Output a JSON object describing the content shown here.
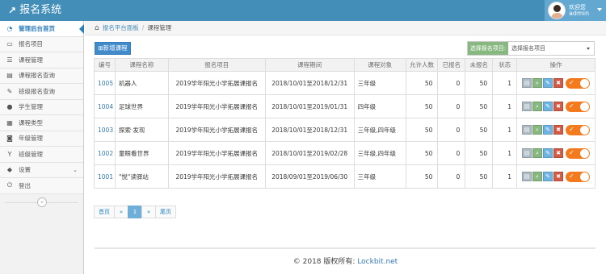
{
  "header": {
    "app_title": "报名系统",
    "welcome": "欢迎您",
    "username": "admin"
  },
  "sidebar": {
    "items": [
      {
        "label": "管理后台首页",
        "icon": "dashboard-icon",
        "glyph": "◔"
      },
      {
        "label": "报名项目",
        "icon": "monitor-icon",
        "glyph": "▭"
      },
      {
        "label": "课程管理",
        "icon": "list-icon",
        "glyph": "☰"
      },
      {
        "label": "课程报名查询",
        "icon": "list-alt-icon",
        "glyph": "▤"
      },
      {
        "label": "班级报名查询",
        "icon": "edit-icon",
        "glyph": "✎"
      },
      {
        "label": "学生管理",
        "icon": "user-icon",
        "glyph": "●"
      },
      {
        "label": "课程类型",
        "icon": "calendar-icon",
        "glyph": "▦"
      },
      {
        "label": "年级管理",
        "icon": "car-icon",
        "glyph": "◙"
      },
      {
        "label": "班级管理",
        "icon": "glass-icon",
        "glyph": "Y"
      },
      {
        "label": "设置",
        "icon": "tag-icon",
        "glyph": "◆"
      },
      {
        "label": "登出",
        "icon": "power-icon",
        "glyph": "⏻"
      }
    ],
    "collapse_glyph": "«"
  },
  "breadcrumb": {
    "home": "报名平台面板",
    "current": "课程管理",
    "separator": "/"
  },
  "toolbar": {
    "add_label": "新增课程",
    "filter_label": "选择报名项目:",
    "filter_value": "选择报名项目"
  },
  "table": {
    "columns": [
      "编号",
      "课程名称",
      "报名项目",
      "课程期间",
      "课程对象",
      "允许人数",
      "已报名",
      "未报名",
      "状态",
      "操作"
    ],
    "rows": [
      {
        "id": "1005",
        "name": "机器人",
        "project": "2019学年阳光小学拓展课报名",
        "period": "2018/10/01至2018/12/31",
        "target": "三年级",
        "allowed": "50",
        "enrolled": "0",
        "remaining": "50",
        "status": "1"
      },
      {
        "id": "1004",
        "name": "足球世界",
        "project": "2019学年阳光小学拓展课报名",
        "period": "2018/10/01至2019/01/31",
        "target": "四年级",
        "allowed": "50",
        "enrolled": "0",
        "remaining": "50",
        "status": "1"
      },
      {
        "id": "1003",
        "name": "探索·发现",
        "project": "2019学年阳光小学拓展课报名",
        "period": "2018/10/01至2018/12/31",
        "target": "三年级,四年级",
        "allowed": "50",
        "enrolled": "0",
        "remaining": "50",
        "status": "1"
      },
      {
        "id": "1002",
        "name": "童眼看世界",
        "project": "2019学年阳光小学拓展课报名",
        "period": "2018/10/01至2019/02/28",
        "target": "三年级,四年级",
        "allowed": "50",
        "enrolled": "0",
        "remaining": "50",
        "status": "1"
      },
      {
        "id": "1001",
        "name": "\"悦\"读驿站",
        "project": "2019学年阳光小学拓展课报名",
        "period": "2018/09/01至2019/06/30",
        "target": "三年级",
        "allowed": "50",
        "enrolled": "0",
        "remaining": "50",
        "status": "1"
      }
    ]
  },
  "pagination": {
    "first": "首页",
    "prev": "«",
    "current": "1",
    "next": "»",
    "last": "尾页"
  },
  "footer": {
    "copyright": "© 2018 版权所有:",
    "link": "Lockbit.net"
  },
  "colors": {
    "header_bg": "#438eb9",
    "user_bg": "#62a8d1",
    "primary": "#428bca",
    "filter_label": "#87b87f",
    "toggle": "#f37b1d"
  }
}
